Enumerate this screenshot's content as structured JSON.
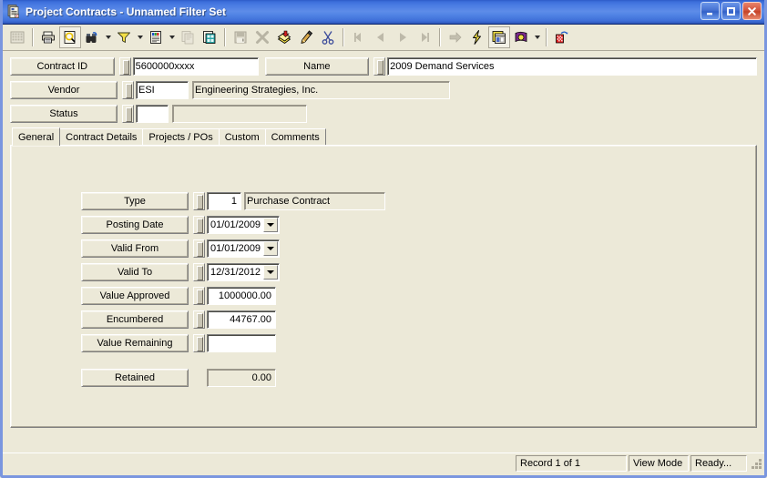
{
  "window": {
    "title": "Project Contracts - Unnamed Filter Set",
    "app_icon": "document-contract-icon",
    "minimize_label": "Minimize",
    "maximize_label": "Maximize",
    "close_label": "Close",
    "accent_titlebar": "#4A7CE3",
    "accent_border": "#7A96DF",
    "face_color": "#ECE9D8"
  },
  "toolbar": {
    "buttons": [
      {
        "name": "grid-view-icon",
        "title": "Grid View",
        "disabled": true
      },
      {
        "name": "print-icon",
        "title": "Print"
      },
      {
        "name": "print-preview-icon",
        "title": "Print Preview"
      },
      {
        "name": "find-binoculars-icon",
        "title": "Find",
        "dropdown": true
      },
      {
        "name": "filter-funnel-icon",
        "title": "Filter",
        "dropdown": true
      },
      {
        "name": "report-icon",
        "title": "Report",
        "dropdown": true
      },
      {
        "name": "copy-record-icon",
        "title": "Copy Record",
        "disabled": true
      },
      {
        "name": "duplicate-record-icon",
        "title": "Duplicate Record"
      },
      {
        "name": "save-icon",
        "title": "Save",
        "disabled": true
      },
      {
        "name": "delete-x-icon",
        "title": "Delete",
        "disabled": true
      },
      {
        "name": "new-record-icon",
        "title": "New Record"
      },
      {
        "name": "edit-pencil-icon",
        "title": "Edit"
      },
      {
        "name": "cut-scissors-icon",
        "title": "Cut"
      },
      {
        "name": "first-record-icon",
        "title": "First Record",
        "disabled": true
      },
      {
        "name": "previous-record-icon",
        "title": "Previous Record",
        "disabled": true
      },
      {
        "name": "next-record-icon",
        "title": "Next Record",
        "disabled": true
      },
      {
        "name": "last-record-icon",
        "title": "Last Record",
        "disabled": true
      },
      {
        "name": "goto-arrow-icon",
        "title": "Go To",
        "disabled": true
      },
      {
        "name": "lightning-process-icon",
        "title": "Process"
      },
      {
        "name": "window-layout-icon",
        "title": "Layout"
      },
      {
        "name": "help-book-icon",
        "title": "Help",
        "dropdown": true
      },
      {
        "name": "exit-door-icon",
        "title": "Exit"
      }
    ]
  },
  "header": {
    "fields": [
      {
        "label": "Contract ID",
        "value": "5600000xxxx",
        "desc": null
      },
      {
        "label": "Name",
        "value": "2009 Demand Services",
        "desc": null
      },
      {
        "label": "Vendor",
        "value": "ESI",
        "desc": "Engineering Strategies, Inc."
      },
      {
        "label": "Status",
        "value": "",
        "desc": ""
      }
    ]
  },
  "tabs": {
    "items": [
      {
        "label": "General",
        "active": true
      },
      {
        "label": "Contract Details",
        "active": false
      },
      {
        "label": "Projects / POs",
        "active": false
      },
      {
        "label": "Custom",
        "active": false
      },
      {
        "label": "Comments",
        "active": false
      }
    ]
  },
  "general": {
    "type": {
      "label": "Type",
      "code": "1",
      "description": "Purchase Contract"
    },
    "posting_date": {
      "label": "Posting Date",
      "value": "01/01/2009"
    },
    "valid_from": {
      "label": "Valid From",
      "value": "01/01/2009"
    },
    "valid_to": {
      "label": "Valid To",
      "value": "12/31/2012"
    },
    "value_approved": {
      "label": "Value Approved",
      "value": "1000000.00"
    },
    "encumbered": {
      "label": "Encumbered",
      "value": "44767.00"
    },
    "value_remaining": {
      "label": "Value Remaining",
      "value": ""
    },
    "retained": {
      "label": "Retained",
      "value": "0.00"
    }
  },
  "statusbar": {
    "record": "Record 1 of 1",
    "mode": "View Mode",
    "state": "Ready...",
    "gripper": "resize-gripper-icon"
  }
}
